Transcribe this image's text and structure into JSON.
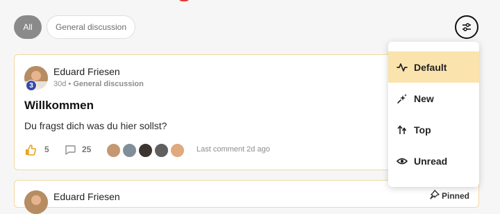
{
  "filters": {
    "all_label": "All",
    "category_label": "General discussion"
  },
  "sort_menu": {
    "items": [
      {
        "label": "Default",
        "icon": "activity-icon",
        "active": true
      },
      {
        "label": "New",
        "icon": "sparkle-icon",
        "active": false
      },
      {
        "label": "Top",
        "icon": "sort-arrows-icon",
        "active": false
      },
      {
        "label": "Unread",
        "icon": "eye-icon",
        "active": false
      }
    ]
  },
  "topics": [
    {
      "author": "Eduard Friesen",
      "level": "3",
      "age": "30d",
      "separator": "•",
      "category": "General discussion",
      "title": "Willkommen",
      "excerpt": "Du fragst dich was du hier sollst?",
      "likes": "5",
      "comments": "25",
      "last_comment": "Last comment 2d ago"
    },
    {
      "author": "Eduard Friesen",
      "pinned_label": "Pinned"
    }
  ],
  "colors": {
    "accent_bg": "#fbe3ae",
    "card_border": "#f3d9a3",
    "level_badge": "#3949ab",
    "chip_active": "#8a8a8a"
  }
}
